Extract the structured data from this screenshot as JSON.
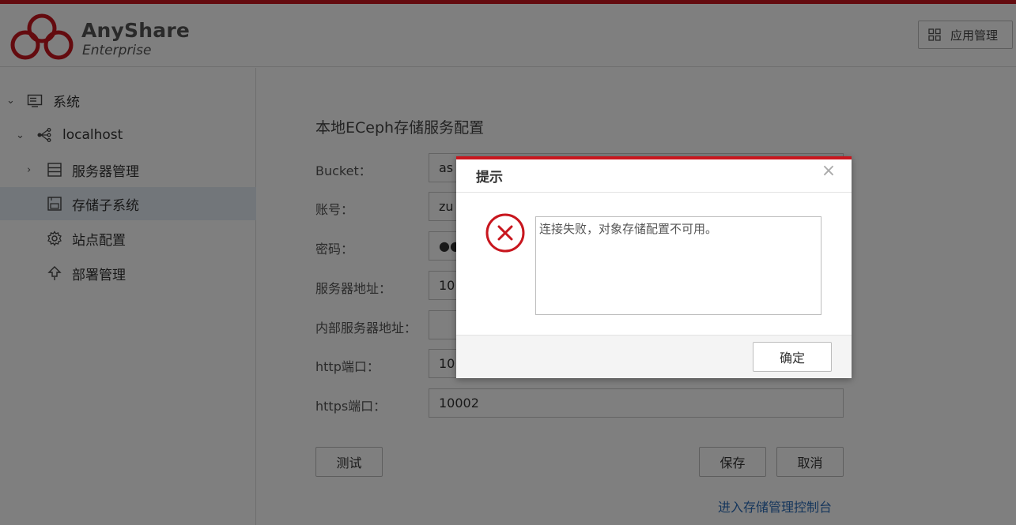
{
  "brand": {
    "name": "AnyShare",
    "subtitle": "Enterprise"
  },
  "header": {
    "app_manage_label": "应用管理",
    "app_manage_icon": "grid-icon"
  },
  "sidebar": {
    "items": [
      {
        "label": "系统",
        "icon": "system-icon",
        "expanded": true
      },
      {
        "label": "localhost",
        "icon": "share-node-icon",
        "expanded": true
      },
      {
        "label": "服务器管理",
        "icon": "server-icon",
        "expanded": false
      },
      {
        "label": "存储子系统",
        "icon": "storage-icon",
        "active": true
      },
      {
        "label": "站点配置",
        "icon": "gear-icon"
      },
      {
        "label": "部署管理",
        "icon": "upload-icon"
      }
    ]
  },
  "form": {
    "title": "本地ECeph存储服务配置",
    "fields": [
      {
        "label": "Bucket：",
        "value": "as"
      },
      {
        "label": "账号：",
        "value": "zu"
      },
      {
        "label": "密码：",
        "value": "●●"
      },
      {
        "label": "服务器地址：",
        "value": "10"
      },
      {
        "label": "内部服务器地址：",
        "value": ""
      },
      {
        "label": "http端口：",
        "value": "10"
      },
      {
        "label": "https端口：",
        "value": "10002"
      }
    ],
    "test_label": "测试",
    "save_label": "保存",
    "cancel_label": "取消",
    "console_link": "进入存储管理控制台"
  },
  "dialog": {
    "title": "提示",
    "message": "连接失败，对象存储配置不可用。",
    "ok_label": "确定",
    "accent_color": "#c8161e"
  }
}
